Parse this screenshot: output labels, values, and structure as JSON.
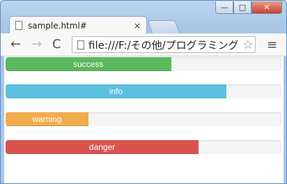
{
  "tab": {
    "title": "sample.html#",
    "close_glyph": "×"
  },
  "toolbar": {
    "back_glyph": "←",
    "forward_glyph": "→",
    "reload_glyph": "C",
    "menu_glyph": "≡",
    "star_glyph": "☆"
  },
  "address": {
    "url": "file:///F:/その他/プログラミング"
  },
  "window_controls": {
    "min": "—",
    "max": "□",
    "close": "✕"
  },
  "progress_bars": [
    {
      "label": "success",
      "percent": 60,
      "color": "#5cb85c"
    },
    {
      "label": "info",
      "percent": 80,
      "color": "#5bc0de"
    },
    {
      "label": "warning",
      "percent": 30,
      "color": "#f0ad4e"
    },
    {
      "label": "danger",
      "percent": 70,
      "color": "#d9534f"
    }
  ]
}
